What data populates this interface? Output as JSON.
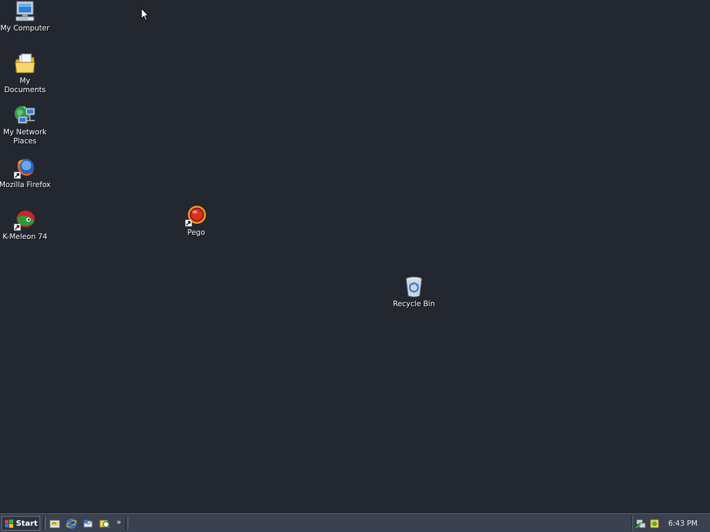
{
  "desktop": {
    "background_color": "#222730",
    "icons": [
      {
        "label": "My Computer",
        "icon": "my-computer-icon",
        "shortcut": false
      },
      {
        "label": "My Documents",
        "icon": "folder-documents-icon",
        "shortcut": false
      },
      {
        "label": "My Network Places",
        "icon": "network-places-icon",
        "shortcut": false
      },
      {
        "label": "Mozilla Firefox",
        "icon": "firefox-icon",
        "shortcut": true
      },
      {
        "label": "K-Meleon 74",
        "icon": "kmeleon-icon",
        "shortcut": true
      },
      {
        "label": "Pego",
        "icon": "pego-icon",
        "shortcut": true
      },
      {
        "label": "Recycle Bin",
        "icon": "recycle-bin-icon",
        "shortcut": false
      }
    ]
  },
  "taskbar": {
    "start_label": "Start",
    "quick_launch": [
      "show-desktop-icon",
      "internet-explorer-icon",
      "outlook-express-icon",
      "media-icon"
    ],
    "overflow_label": "»",
    "tray_icons": [
      "network-status-icon",
      "security-shield-icon"
    ],
    "clock": "6:43 PM"
  },
  "colors": {
    "taskbar": "#3a4150",
    "label_text": "#ffffff"
  }
}
